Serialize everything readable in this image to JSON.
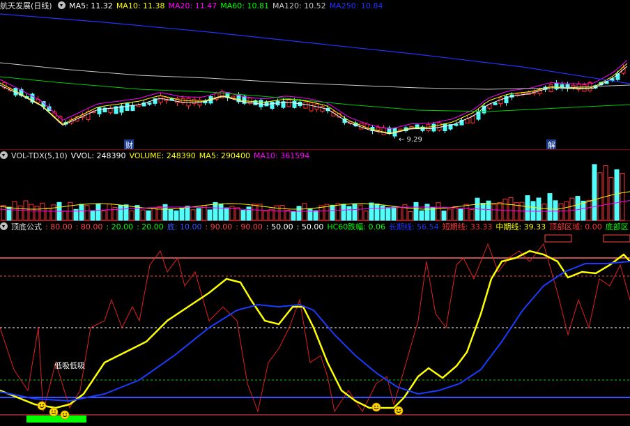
{
  "panel1": {
    "stock_name": "航天发展",
    "period": "(日线)",
    "ma_items": [
      {
        "label": "MA5: 11.32",
        "color": "#ffffff"
      },
      {
        "label": "MA10: 11.38",
        "color": "#ffff00"
      },
      {
        "label": "MA20: 11.47",
        "color": "#ff00ff"
      },
      {
        "label": "MA60: 10.81",
        "color": "#00ff00"
      },
      {
        "label": "MA120: 10.52",
        "color": "#c8c8c8"
      },
      {
        "label": "MA250: 10.84",
        "color": "#2233ff"
      }
    ],
    "low_marker": "9.29",
    "events": [
      "财",
      "解"
    ]
  },
  "panel2": {
    "title": "VOL-TDX(5,10)",
    "items": [
      {
        "label": "VVOL: 248390",
        "color": "#ffffff"
      },
      {
        "label": "VOLUME: 248390",
        "color": "#ffff00"
      },
      {
        "label": "MA5: 290400",
        "color": "#ffff00"
      },
      {
        "label": "MA10: 361594",
        "color": "#ff00ff"
      }
    ]
  },
  "panel3": {
    "title": "顶底公式",
    "items": [
      {
        "label": ": 80.00",
        "color": "#ff4444"
      },
      {
        "label": ": 80.00",
        "color": "#ff4444"
      },
      {
        "label": ": 20.00",
        "color": "#00ff00"
      },
      {
        "label": ": 20.00",
        "color": "#00ff00"
      },
      {
        "label": "底: 10.00",
        "color": "#3355ff"
      },
      {
        "label": ": 90.00",
        "color": "#ff4444"
      },
      {
        "label": ": 90.00",
        "color": "#ff4444"
      },
      {
        "label": ": 50.00",
        "color": "#ffffff"
      },
      {
        "label": ": 50.00",
        "color": "#ffffff"
      },
      {
        "label": "HC60跌幅: 0.06",
        "color": "#00ff00"
      },
      {
        "label": "长期线: 56.54",
        "color": "#2233ff"
      },
      {
        "label": "短期线: 33.33",
        "color": "#ff3333"
      },
      {
        "label": "中期线: 39.33",
        "color": "#ffff00"
      },
      {
        "label": "顶部区域: 0.00",
        "color": "#ff3333"
      },
      {
        "label": "底部区",
        "color": "#00ff00"
      }
    ],
    "annotation": "低吸低吸"
  },
  "colors": {
    "up": "#ff3232",
    "down": "#54fcfc",
    "bg": "#000000"
  }
}
